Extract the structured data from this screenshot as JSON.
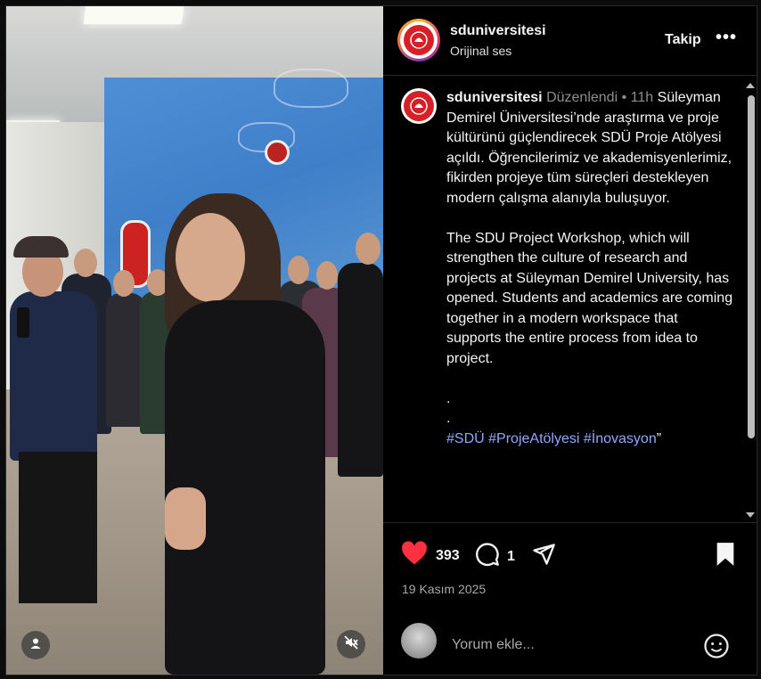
{
  "post": {
    "username": "sduniversitesi",
    "audio": "Orijinal ses",
    "follow_label": "Takip",
    "more_label": "•••"
  },
  "caption": {
    "username": "sduniversitesi",
    "edited": "Düzenlendi",
    "separator": "•",
    "time": "11h",
    "turkish": "Süleyman Demirel Üniversitesi’nde araştırma ve proje kültürünü güçlendirecek SDÜ Proje Atölyesi açıldı. Öğrencilerimiz ve akademisyenlerimiz, fikirden projeye tüm süreçleri destekleyen modern çalışma alanıyla buluşuyor.",
    "english": "The SDU Project Workshop, which will strengthen the culture of research and projects at Süleyman Demirel University, has opened. Students and academics are coming together in a modern workspace that supports the entire process from idea to project.",
    "dot1": ".",
    "dot2": ".",
    "hashtags": [
      "#SDÜ",
      "#ProjeAtölyesi",
      "#İnovasyon"
    ],
    "closing_quote": "”"
  },
  "actions": {
    "likes": "393",
    "comments": "1",
    "date": "19 Kasım 2025",
    "comment_placeholder": "Yorum ekle..."
  },
  "icons": {
    "like": "heart-icon",
    "comment": "comment-icon",
    "share": "share-icon",
    "save": "bookmark-icon",
    "emoji": "emoji-icon",
    "user": "user-icon",
    "mute": "speaker-muted-icon"
  },
  "colors": {
    "like": "#ff3040",
    "hashtag": "#8fa8ff",
    "brand_red": "#d61f26"
  }
}
